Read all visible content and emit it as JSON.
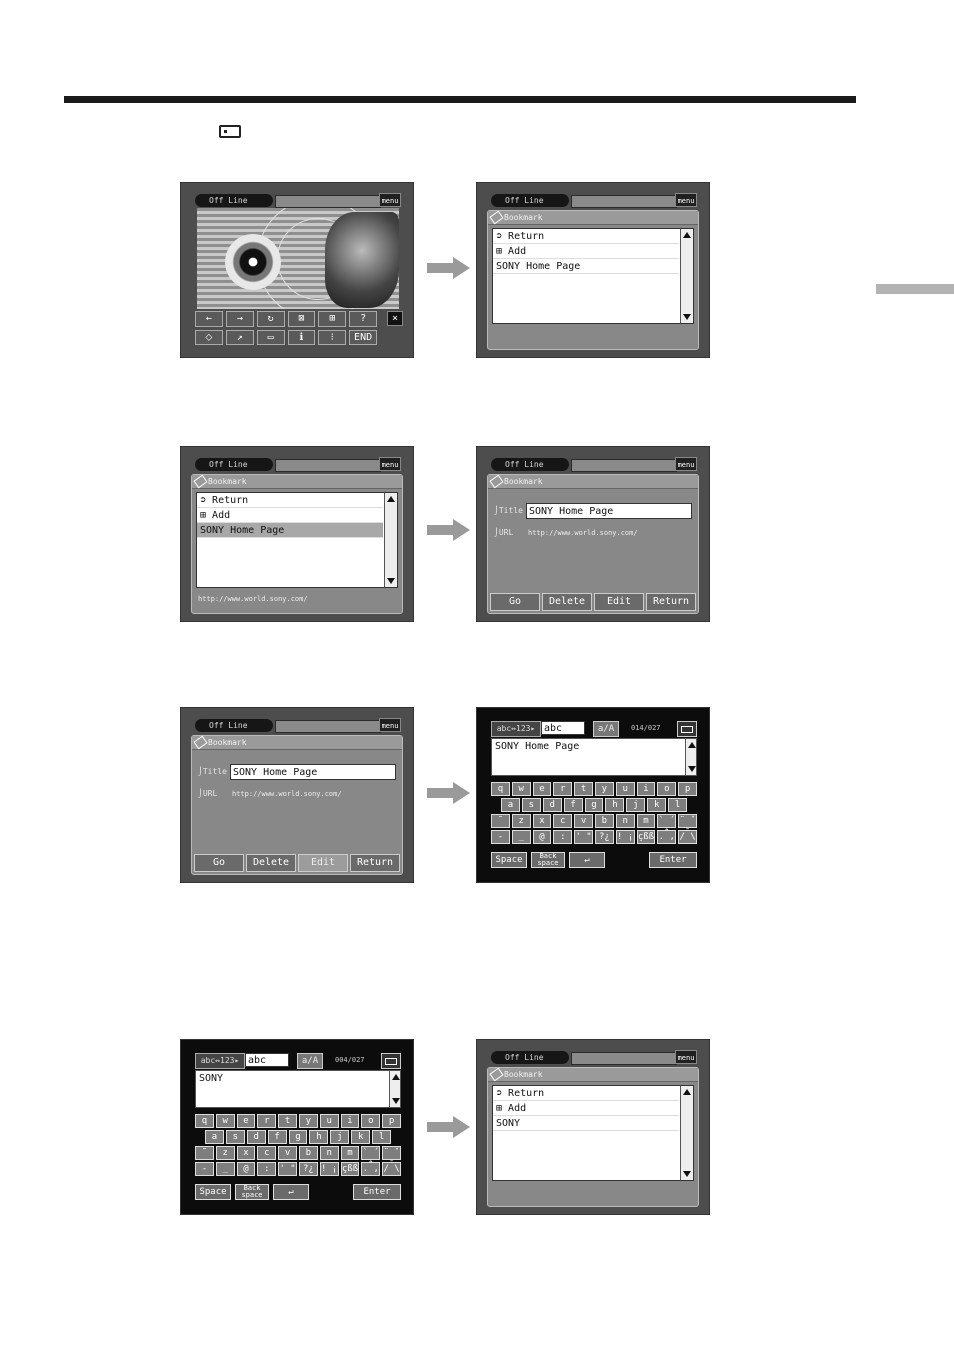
{
  "panels": {
    "status_label": "Off Line",
    "menu_label": "menu",
    "bookmark_title": "Bookmark",
    "return_item": "Return",
    "add_item": "Add",
    "sony_home": "SONY Home Page",
    "sony_short": "SONY",
    "url": "http://www.world.sony.com/",
    "title_label": "Title",
    "url_label": "URL",
    "buttons": {
      "go": "Go",
      "delete": "Delete",
      "edit": "Edit",
      "return": "Return"
    },
    "toolbar": {
      "back": "←",
      "forward": "→",
      "reload": "↻",
      "stop": "⊠",
      "zoom": "⊞",
      "help": "?",
      "bookmark": "⬦",
      "jump": "↗",
      "frame": "▭",
      "info": "ℹ",
      "split": "⁝",
      "end": "END",
      "close": "×"
    }
  },
  "keyboard": {
    "mode": "abc↔123▸",
    "input": "abc",
    "case": "a/A",
    "count_1": "014/027",
    "count_2": "004/027",
    "row1": [
      "q",
      "w",
      "e",
      "r",
      "t",
      "y",
      "u",
      "i",
      "o",
      "p"
    ],
    "row2": [
      "a",
      "s",
      "d",
      "f",
      "g",
      "h",
      "j",
      "k",
      "l"
    ],
    "row3": [
      "˜",
      "z",
      "x",
      "c",
      "v",
      "b",
      "n",
      "m",
      "` ´ ^",
      "¨ ˇ ˉ"
    ],
    "row4": [
      "-",
      "_",
      "@",
      ":",
      "' \"",
      "?¿",
      "! ¡",
      "çßß",
      ". ,",
      "/ \\"
    ],
    "space": "Space",
    "backspace_top": "Back",
    "backspace_bottom": "space",
    "newline": "↵",
    "enter": "Enter"
  }
}
